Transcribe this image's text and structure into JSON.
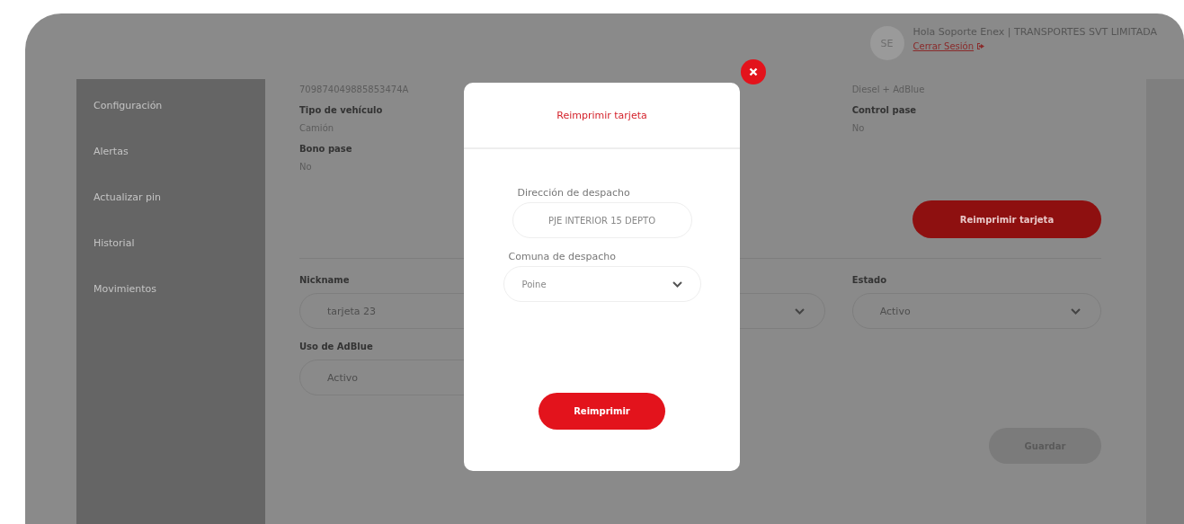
{
  "header": {
    "avatar": "SE",
    "greeting": "Hola Soporte Enex | TRANSPORTES SVT LIMITADA",
    "logout": "Cerrar Sesión"
  },
  "sidebar": {
    "items": [
      {
        "label": "Configuración"
      },
      {
        "label": "Alertas"
      },
      {
        "label": "Actualizar pin"
      },
      {
        "label": "Historial"
      },
      {
        "label": "Movimientos"
      }
    ]
  },
  "details_left": [
    {
      "value": "709874049885853474A"
    },
    {
      "label": "Tipo de vehículo",
      "value": "Camión"
    },
    {
      "label": "Bono pase",
      "value": "No"
    }
  ],
  "details_right": [
    {
      "value": "Diesel + AdBlue"
    },
    {
      "label": "Control pase",
      "value": "No"
    }
  ],
  "reprint_button": "Reimprimir tarjeta",
  "form": [
    {
      "kind": "input",
      "label": "Nickname",
      "value": "tarjeta 23"
    },
    {
      "kind": "select"
    },
    {
      "kind": "select",
      "label": "Estado",
      "value": "Activo"
    },
    {
      "kind": "select",
      "label": "Uso de AdBlue",
      "value": "Activo"
    }
  ],
  "save_button": {
    "label": "Guardar",
    "disabled": true
  },
  "modal": {
    "title": "Reimprimir tarjeta",
    "fields": [
      {
        "kind": "input",
        "label": "Dirección de despacho",
        "value": "PJE INTERIOR 15 DEPTO"
      },
      {
        "kind": "select",
        "label": "Comuna de despacho",
        "value": "Poine"
      }
    ],
    "submit": "Reimprimir"
  }
}
